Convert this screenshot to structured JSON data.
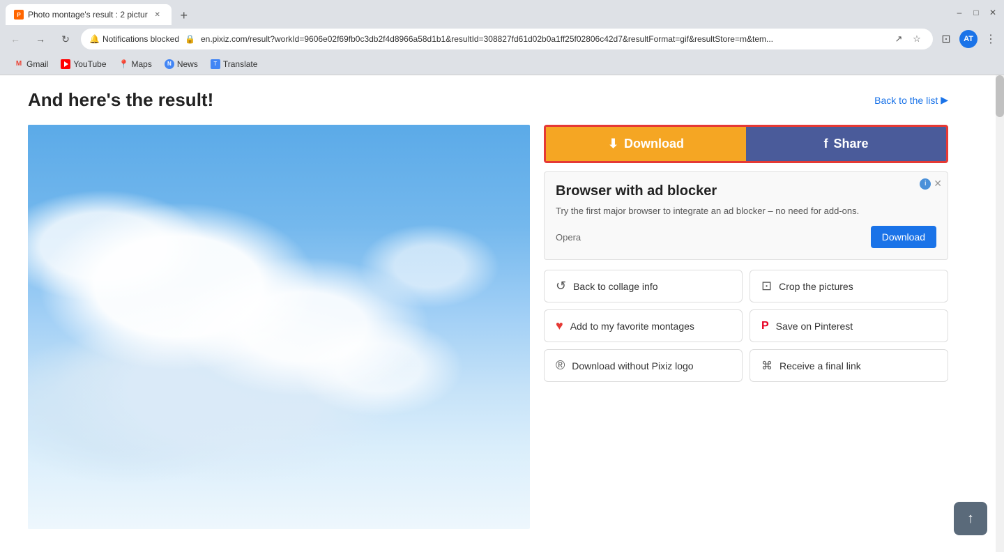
{
  "browser": {
    "tab": {
      "title": "Photo montage's result : 2 pictur",
      "favicon": "P"
    },
    "address": {
      "notifications_blocked": "Notifications blocked",
      "url": "en.pixiz.com/result?workId=9606e02f69fb0c3db2f4d8966a58d1b1&resultId=308827fd61d02b0a1ff25f02806c42d7&resultFormat=gif&resultStore=m&tem..."
    },
    "bookmarks": [
      {
        "label": "Gmail",
        "type": "gmail"
      },
      {
        "label": "YouTube",
        "type": "youtube"
      },
      {
        "label": "Maps",
        "type": "maps"
      },
      {
        "label": "News",
        "type": "news"
      },
      {
        "label": "Translate",
        "type": "translate"
      }
    ],
    "profile_initials": "AT"
  },
  "page": {
    "heading": "And here's the result!",
    "back_to_list": "Back to the list",
    "back_to_list_arrow": "▶"
  },
  "actions": {
    "download_label": "Download",
    "share_label": "Share",
    "facebook_icon": "f"
  },
  "ad": {
    "title": "Browser with ad blocker",
    "description": "Try the first major browser to integrate an ad blocker – no need for add-ons.",
    "brand": "Opera",
    "cta_label": "Download"
  },
  "extra_actions": [
    {
      "id": "back-to-collage",
      "icon": "↺",
      "label": "Back to collage info"
    },
    {
      "id": "crop-pictures",
      "icon": "⊡",
      "label": "Crop the pictures"
    },
    {
      "id": "favorite",
      "icon": "♥",
      "label": "Add to my favorite montages"
    },
    {
      "id": "pinterest",
      "icon": "P",
      "label": "Save on Pinterest"
    },
    {
      "id": "no-logo",
      "icon": "®",
      "label": "Download without Pixiz logo"
    },
    {
      "id": "final-link",
      "icon": "⌘",
      "label": "Receive a final link"
    }
  ],
  "back_to_top_icon": "↑"
}
